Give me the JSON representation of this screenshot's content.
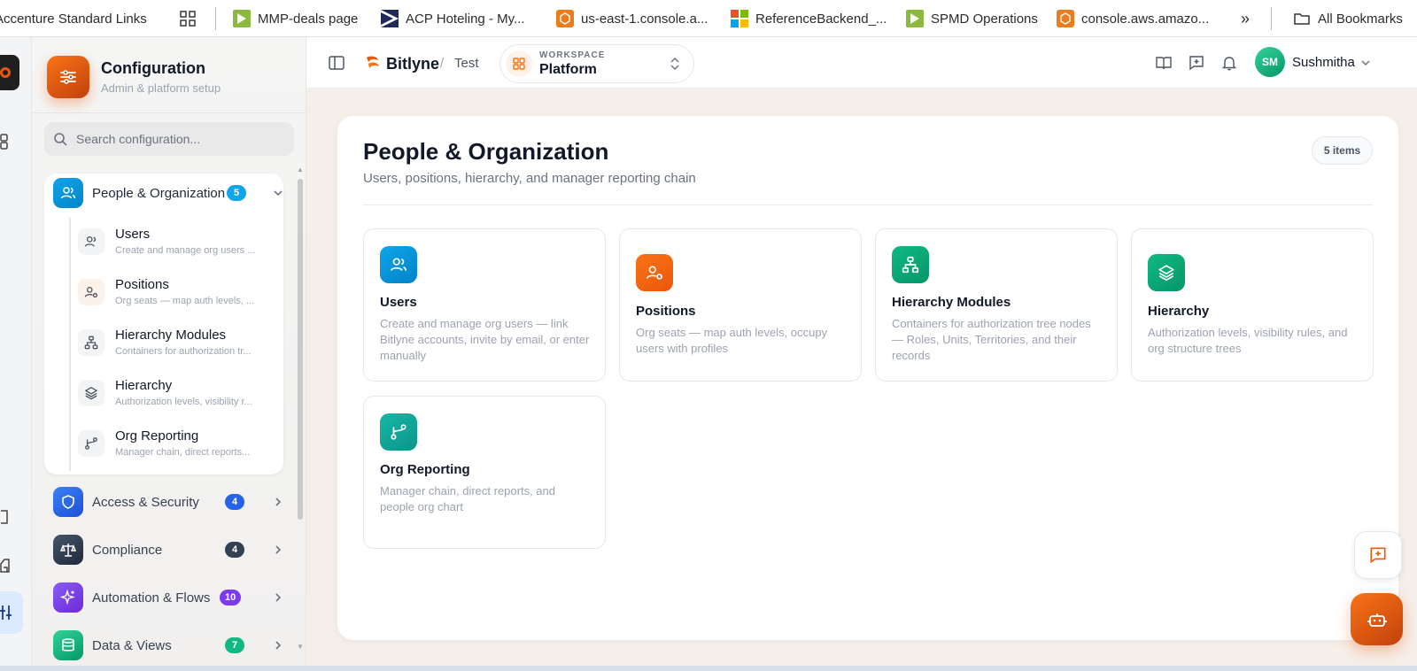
{
  "bookmarks": {
    "items": [
      {
        "label": "Accenture Standard Links"
      },
      {
        "label": "MMP-deals page"
      },
      {
        "label": "ACP Hoteling - My..."
      },
      {
        "label": "us-east-1.console.a..."
      },
      {
        "label": "ReferenceBackend_..."
      },
      {
        "label": "SPMD Operations"
      },
      {
        "label": "console.aws.amazo..."
      }
    ],
    "more_label": "»",
    "all_label": "All Bookmarks"
  },
  "sidebar": {
    "title": "Configuration",
    "subtitle": "Admin & platform setup",
    "search_placeholder": "Search configuration...",
    "open_group": {
      "label": "People & Organization",
      "count": "5",
      "color": "#0ea5e9",
      "items": [
        {
          "title": "Users",
          "desc": "Create and manage org users ..."
        },
        {
          "title": "Positions",
          "desc": "Org seats — map auth levels, ..."
        },
        {
          "title": "Hierarchy Modules",
          "desc": "Containers for authorization tr..."
        },
        {
          "title": "Hierarchy",
          "desc": "Authorization levels, visibility r..."
        },
        {
          "title": "Org Reporting",
          "desc": "Manager chain, direct reports..."
        }
      ]
    },
    "groups": [
      {
        "label": "Access & Security",
        "count": "4",
        "color": "#2563eb"
      },
      {
        "label": "Compliance",
        "count": "4",
        "color": "#334155"
      },
      {
        "label": "Automation & Flows",
        "count": "10",
        "color": "#7c3aed"
      },
      {
        "label": "Data & Views",
        "count": "7",
        "color": "#10b981"
      }
    ]
  },
  "topbar": {
    "brand": "Bitlyne",
    "breadcrumb_sep": "/",
    "crumb": "Test",
    "workspace_label": "WORKSPACE",
    "workspace_value": "Platform",
    "avatar_initials": "SM",
    "user_name": "Sushmitha"
  },
  "main": {
    "title": "People & Organization",
    "subtitle": "Users, positions, hierarchy, and manager reporting chain",
    "count_badge": "5 items",
    "cards": [
      {
        "title": "Users",
        "desc": "Create and manage org users — link Bitlyne accounts, invite by email, or enter manually",
        "color": "#0ea5e9"
      },
      {
        "title": "Positions",
        "desc": "Org seats — map auth levels, occupy users with profiles",
        "color": "#f97316"
      },
      {
        "title": "Hierarchy Modules",
        "desc": "Containers for authorization tree nodes — Roles, Units, Territories, and their records",
        "color": "#10b981"
      },
      {
        "title": "Hierarchy",
        "desc": "Authorization levels, visibility rules, and org structure trees",
        "color": "#10b981"
      },
      {
        "title": "Org Reporting",
        "desc": "Manager chain, direct reports, and people org chart",
        "color": "#14b8a6"
      }
    ]
  }
}
